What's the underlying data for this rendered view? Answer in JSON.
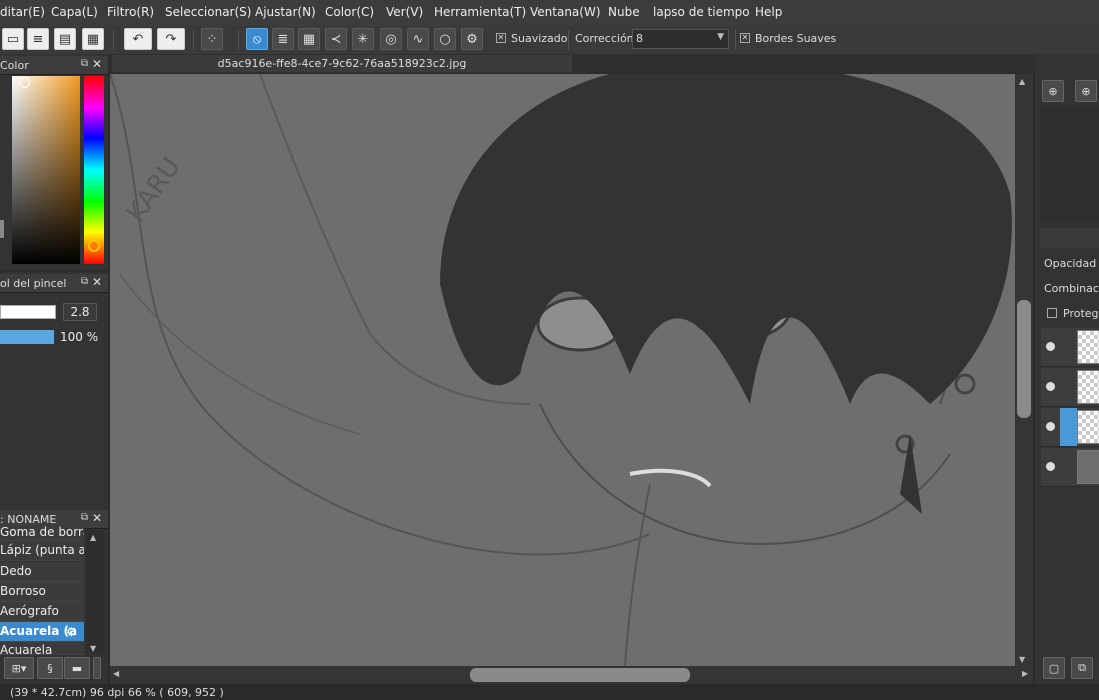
{
  "menu": [
    "ditar(E)",
    "Capa(L)",
    "Filtro(R)",
    "Seleccionar(S)",
    "Ajustar(N)",
    "Color(C)",
    "Ver(V)",
    "Herramienta(T)",
    "Ventana(W)",
    "Nube",
    "lapso de tiempo",
    "Help"
  ],
  "toolbar": {
    "smoothing_label": "Suavizado",
    "correction_label": "Corrección",
    "correction_value": "8",
    "soft_edges_label": "Bordes Suaves",
    "smoothing_checked": true,
    "soft_edges_checked": true
  },
  "panels": {
    "color": {
      "title": "Color"
    },
    "brush_control": {
      "title": "ol del pincel",
      "size_value": "2.8",
      "opacity_value": "100 %"
    },
    "brush_list": {
      "title": ": NONAME",
      "items": [
        "Goma de borrar",
        "Lápiz (punta ag",
        "Dedo",
        "Borroso",
        "Aerógrafo",
        "Acuarela (a",
        "Acuarela"
      ],
      "selected": 5
    }
  },
  "document": {
    "tab_title": "d5ac916e-ffe8-4ce7-9c62-76aa518923c2.jpg",
    "watermark_text": "KARU"
  },
  "layers_panel": {
    "opacity_label": "Opacidad",
    "blend_label": "Combinación",
    "protect_label": "Protege"
  },
  "status": {
    "text": "(39 * 42.7cm)  96 dpi  66 %  ( 609, 952 )"
  },
  "colors": {
    "accent": "#3a8ad0",
    "canvas_bg": "#6e6e6e"
  }
}
